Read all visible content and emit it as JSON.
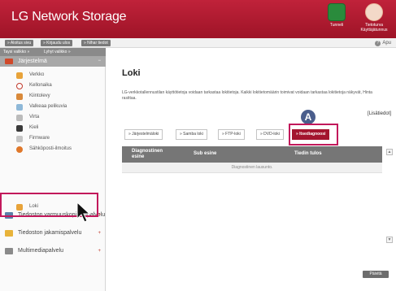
{
  "header": {
    "brand": "LG Network Storage",
    "tunnel_label": "Tunneli",
    "kayttajatunnus_label": "Tietoturva Käyttäjätunnus"
  },
  "toolbar": {
    "buttons": [
      "» Aloitus sivu",
      "» Kirjaudu ulos",
      "» Nihar tiedot"
    ],
    "help_label": "Apu"
  },
  "sidebar": {
    "tabs": [
      "Taysi valikko »",
      "Lyhyt valikko »"
    ],
    "group_title": "Järjestelmä",
    "group_toggle": "−",
    "items": [
      {
        "label": "Verkko"
      },
      {
        "label": "Kellonaika"
      },
      {
        "label": "Kiintolevy"
      },
      {
        "label": "Valkeaa pelikuvia"
      },
      {
        "label": "Virta"
      },
      {
        "label": "Kieli"
      },
      {
        "label": "Firmware"
      },
      {
        "label": "Sähköposti-ilmoitus"
      }
    ],
    "active_item": "Loki",
    "groups": [
      {
        "label": "Tiedoston varmuuskopiointipalvelu",
        "toggle": "+"
      },
      {
        "label": "Tiedoston jakamispalvelu",
        "toggle": "+"
      },
      {
        "label": "Multimediapalvelu",
        "toggle": "+"
      }
    ]
  },
  "main": {
    "title": "Loki",
    "description": "LG-verkkotallennustilan käyttötietoja voidaan tarkastaa lokitietoja. Kaikki lokitietomäärin toimivat voidaan tarkastaa lokitietoja näkyvät, Hinta rasittaa.",
    "details_link": "[Lisätiedot]",
    "callout": "A",
    "tabs": [
      {
        "label": "» Järjestelmäloki",
        "active": false
      },
      {
        "label": "» Samba loki",
        "active": false
      },
      {
        "label": "» FTP-loki",
        "active": false
      },
      {
        "label": "» DVD-loki",
        "active": false
      },
      {
        "label": "» Itsediagnoosi",
        "active": true
      }
    ],
    "table": {
      "columns": [
        "Diagnostinen esine",
        "Sub esine",
        "Tiedin tulos"
      ],
      "empty_text": "Diagnostinen lausunto."
    },
    "refresh_label": "Päivitä"
  },
  "colors": {
    "brand_red": "#a3142e",
    "highlight": "#c2185b",
    "callout": "#4a5e8c"
  }
}
